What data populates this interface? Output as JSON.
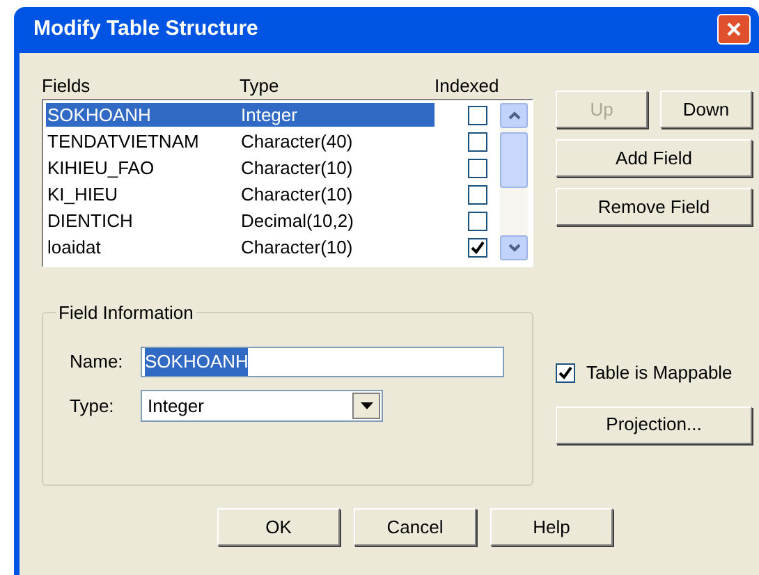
{
  "window": {
    "title": "Modify Table Structure"
  },
  "fields_table": {
    "columns": [
      "Fields",
      "Type",
      "Indexed"
    ],
    "rows": [
      {
        "name": "SOKHOANH",
        "type": "Integer",
        "indexed": false,
        "selected": true
      },
      {
        "name": "TENDATVIETNAM",
        "type": "Character(40)",
        "indexed": false,
        "selected": false
      },
      {
        "name": "KIHIEU_FAO",
        "type": "Character(10)",
        "indexed": false,
        "selected": false
      },
      {
        "name": "KI_HIEU",
        "type": "Character(10)",
        "indexed": false,
        "selected": false
      },
      {
        "name": "DIENTICH",
        "type": "Decimal(10,2)",
        "indexed": false,
        "selected": false
      },
      {
        "name": "loaidat",
        "type": "Character(10)",
        "indexed": true,
        "selected": false
      }
    ]
  },
  "side_buttons": [
    {
      "label": "Up",
      "disabled": true
    },
    {
      "label": "Down",
      "disabled": false
    },
    {
      "label": "Add Field",
      "disabled": false
    },
    {
      "label": "Remove Field",
      "disabled": false
    }
  ],
  "field_information": {
    "title": "Field Information",
    "name_label": "Name:",
    "name_value": "SOKHOANH",
    "type_label": "Type:",
    "type_value": "Integer"
  },
  "table_is_mappable": {
    "label": "Table is Mappable",
    "checked": true
  },
  "projection_button": "Projection...",
  "buttons": [
    "OK",
    "Cancel",
    "Help"
  ]
}
